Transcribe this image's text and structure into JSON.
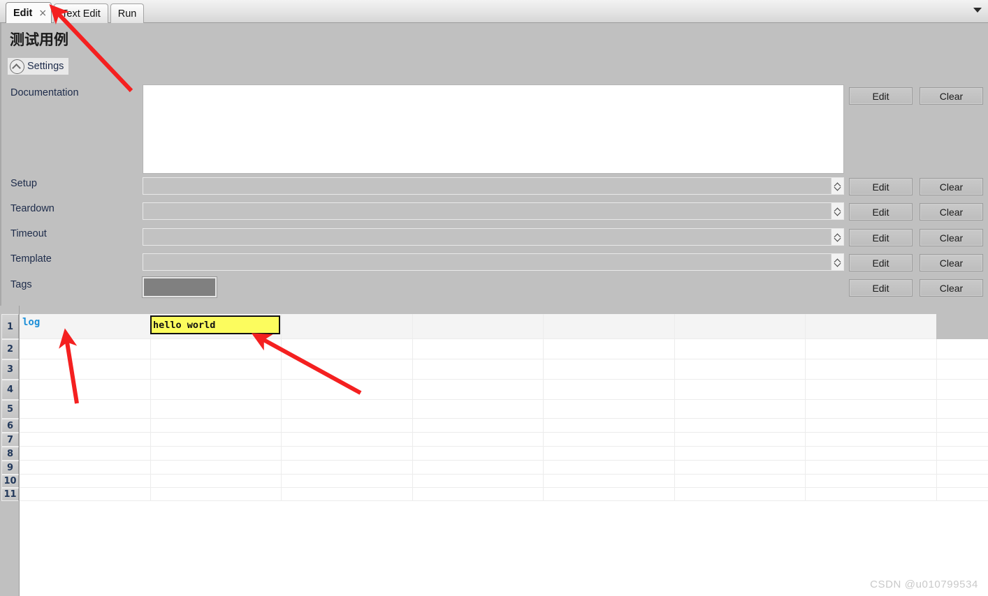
{
  "tabs": [
    {
      "label": "Edit",
      "active": true,
      "closable": true,
      "close_glyph": "×"
    },
    {
      "label": "Text Edit",
      "active": false,
      "closable": false
    },
    {
      "label": "Run",
      "active": false,
      "closable": false
    }
  ],
  "tabbar": {
    "overflow_menu_icon": "chevron-down-icon"
  },
  "panel": {
    "title": "测试用例",
    "settings_label": "Settings",
    "settings_icon": "chevron-up-circle-icon"
  },
  "fields": [
    {
      "label": "Documentation",
      "value": "",
      "type": "textarea",
      "edit": "Edit",
      "clear": "Clear"
    },
    {
      "label": "Setup",
      "value": "",
      "type": "combo",
      "edit": "Edit",
      "clear": "Clear"
    },
    {
      "label": "Teardown",
      "value": "",
      "type": "combo",
      "edit": "Edit",
      "clear": "Clear"
    },
    {
      "label": "Timeout",
      "value": "",
      "type": "combo",
      "edit": "Edit",
      "clear": "Clear"
    },
    {
      "label": "Template",
      "value": "",
      "type": "combo",
      "edit": "Edit",
      "clear": "Clear"
    },
    {
      "label": "Tags",
      "value": "",
      "type": "tags",
      "edit": "Edit",
      "clear": "Clear"
    }
  ],
  "grid": {
    "row_numbers": [
      "1",
      "2",
      "3",
      "4",
      "5",
      "6",
      "7",
      "8",
      "9",
      "10",
      "11"
    ],
    "rows": [
      {
        "cells": [
          "log",
          "hello world",
          "",
          "",
          "",
          "",
          ""
        ]
      },
      {
        "cells": [
          "",
          "",
          "",
          "",
          "",
          "",
          ""
        ]
      },
      {
        "cells": [
          "",
          "",
          "",
          "",
          "",
          "",
          ""
        ]
      },
      {
        "cells": [
          "",
          "",
          "",
          "",
          "",
          "",
          ""
        ]
      },
      {
        "cells": [
          "",
          "",
          "",
          "",
          "",
          "",
          ""
        ]
      },
      {
        "cells": [
          "",
          "",
          "",
          "",
          "",
          "",
          ""
        ]
      },
      {
        "cells": [
          "",
          "",
          "",
          "",
          "",
          "",
          ""
        ]
      },
      {
        "cells": [
          "",
          "",
          "",
          "",
          "",
          "",
          ""
        ]
      },
      {
        "cells": [
          "",
          "",
          "",
          "",
          "",
          "",
          ""
        ]
      },
      {
        "cells": [
          "",
          "",
          "",
          "",
          "",
          "",
          ""
        ]
      },
      {
        "cells": [
          "",
          "",
          "",
          "",
          "",
          "",
          ""
        ]
      }
    ],
    "keyword_cell": "log",
    "selected_cell": {
      "row": 1,
      "column": 2,
      "value": "hello world"
    }
  },
  "colors": {
    "panel_background": "#c0c0c0",
    "keyword_text": "#1d8fd8",
    "selection_fill": "#fcfc5e",
    "selection_border": "#111111",
    "tags_fill": "#808080",
    "annotation_arrow": "#f42020",
    "watermark": "#c9c9c9"
  },
  "annotations": {
    "arrow_count": 3,
    "arrow_targets": [
      "edit-tab",
      "log-keyword-cell",
      "hello-world-cell"
    ]
  },
  "watermark": "CSDN @u010799534"
}
